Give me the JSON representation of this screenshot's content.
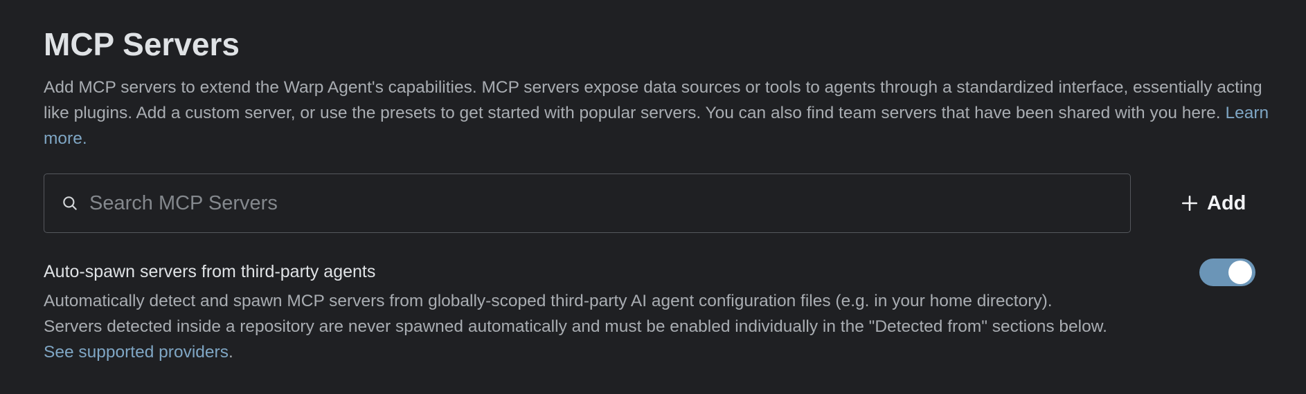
{
  "header": {
    "title": "MCP Servers",
    "description": "Add MCP servers to extend the Warp Agent's capabilities. MCP servers expose data sources or tools to agents through a standardized interface, essentially acting like plugins. Add a custom server, or use the presets to get started with popular servers. You can also find team servers that have been shared with you here.",
    "learn_more_label": "Learn more."
  },
  "search": {
    "placeholder": "Search MCP Servers",
    "value": "",
    "icon": "search-icon"
  },
  "add_button": {
    "label": "Add",
    "icon": "plus-icon"
  },
  "auto_spawn": {
    "title": "Auto-spawn servers from third-party agents",
    "description_line1": "Automatically detect and spawn MCP servers from globally-scoped third-party AI agent configuration files (e.g. in your home directory).",
    "description_line2": "Servers detected inside a repository are never spawned automatically and must be enabled individually in the \"Detected from\" sections below.",
    "link_label": "See supported providers",
    "link_suffix": ".",
    "enabled": true
  },
  "colors": {
    "background": "#1f2023",
    "accent": "#6b95b7",
    "link": "#7fa6c4",
    "title_text": "#dfe2e5",
    "secondary_text": "#a9adb2"
  }
}
